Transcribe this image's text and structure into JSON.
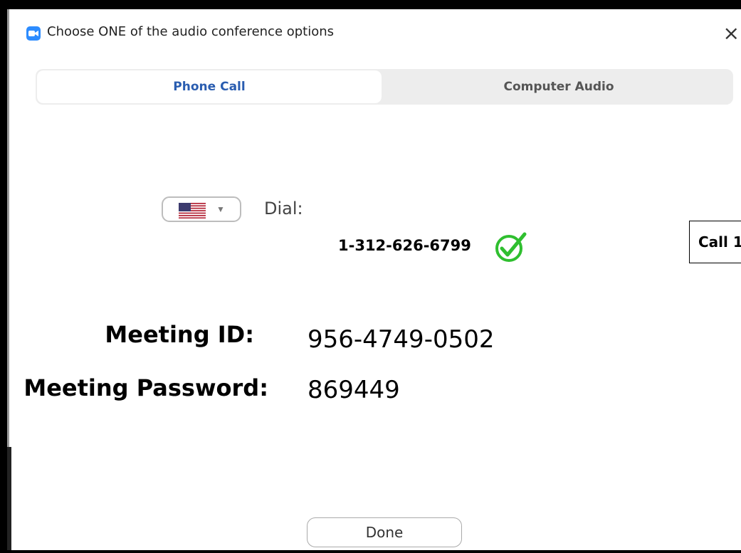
{
  "window": {
    "title": "Choose ONE of the audio conference options",
    "close_glyph": "×"
  },
  "tabs": [
    {
      "label": "Phone Call",
      "selected": true
    },
    {
      "label": "Computer Audio",
      "selected": false
    }
  ],
  "dial": {
    "country_flag": "us-flag-icon",
    "label": "Dial:",
    "number": "1-312-626-6799",
    "verified_icon": "check-circle-icon",
    "verified_color": "#2fbf2f"
  },
  "call_callout": {
    "text": "Call 1"
  },
  "meeting": {
    "id_label": "Meeting ID:",
    "id_value": "956-4749-0502",
    "password_label": "Meeting Password:",
    "password_value": "869449"
  },
  "footer": {
    "done_label": "Done"
  },
  "colors": {
    "accent": "#2a5db0",
    "app_icon": "#2d8cff"
  }
}
